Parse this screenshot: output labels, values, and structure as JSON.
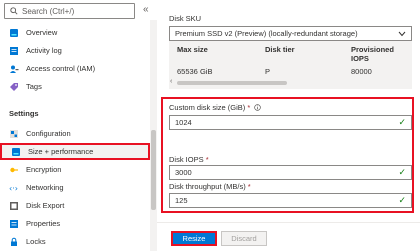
{
  "sidebar": {
    "search_placeholder": "Search (Ctrl+/)",
    "collapse_glyph": "«",
    "items": [
      {
        "label": "Overview",
        "icon": "disk-icon"
      },
      {
        "label": "Activity log",
        "icon": "activity-log-icon"
      },
      {
        "label": "Access control (IAM)",
        "icon": "iam-icon"
      },
      {
        "label": "Tags",
        "icon": "tag-icon"
      }
    ],
    "settings_label": "Settings",
    "settings_items": [
      {
        "label": "Configuration",
        "icon": "configuration-icon"
      },
      {
        "label": "Size + performance",
        "icon": "size-performance-icon",
        "selected": true
      },
      {
        "label": "Encryption",
        "icon": "key-icon"
      },
      {
        "label": "Networking",
        "icon": "networking-icon"
      },
      {
        "label": "Disk Export",
        "icon": "disk-export-icon"
      },
      {
        "label": "Properties",
        "icon": "properties-icon"
      },
      {
        "label": "Locks",
        "icon": "lock-icon"
      }
    ]
  },
  "main": {
    "disk_sku_label": "Disk SKU",
    "disk_sku_value": "Premium SSD v2 (Preview) (locally-redundant storage)",
    "table": {
      "headers": [
        "Max size",
        "Disk tier",
        "Provisioned IOPS"
      ],
      "row": [
        "65536 GiB",
        "P",
        "80000"
      ]
    },
    "custom_size_label": "Custom disk size (GiB)",
    "custom_size_value": "1024",
    "iops_label": "Disk IOPS",
    "iops_value": "3000",
    "throughput_label": "Disk throughput (MB/s)",
    "throughput_value": "125",
    "required_mark": "*",
    "resize_label": "Resize",
    "discard_label": "Discard"
  },
  "colors": {
    "accent": "#0078d4",
    "highlight": "#e81123",
    "valid": "#107c10"
  }
}
